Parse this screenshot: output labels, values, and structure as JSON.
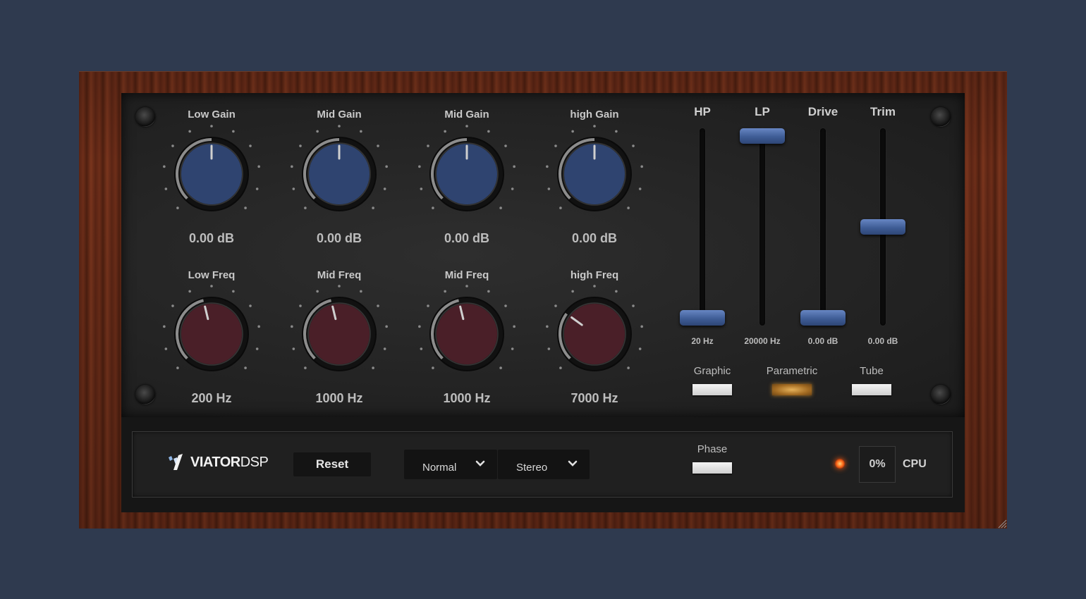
{
  "eq_gain": [
    {
      "label": "Low Gain",
      "value": "0.00 dB",
      "level": 0.5
    },
    {
      "label": "Mid Gain",
      "value": "0.00 dB",
      "level": 0.5
    },
    {
      "label": "Mid Gain",
      "value": "0.00 dB",
      "level": 0.5
    },
    {
      "label": "high Gain",
      "value": "0.00 dB",
      "level": 0.5
    }
  ],
  "eq_freq": [
    {
      "label": "Low Freq",
      "value": "200 Hz",
      "level": 0.45
    },
    {
      "label": "Mid Freq",
      "value": "1000 Hz",
      "level": 0.45
    },
    {
      "label": "Mid Freq",
      "value": "1000 Hz",
      "level": 0.45
    },
    {
      "label": "high Freq",
      "value": "7000 Hz",
      "level": 0.3
    }
  ],
  "sliders": [
    {
      "label": "HP",
      "value": "20 Hz",
      "level": 0.0
    },
    {
      "label": "LP",
      "value": "20000 Hz",
      "level": 1.0
    },
    {
      "label": "Drive",
      "value": "0.00 dB",
      "level": 0.0
    },
    {
      "label": "Trim",
      "value": "0.00 dB",
      "level": 0.5
    }
  ],
  "modes": [
    {
      "label": "Graphic",
      "active": false
    },
    {
      "label": "Parametric",
      "active": true
    },
    {
      "label": "Tube",
      "active": false
    }
  ],
  "footer": {
    "logo_brand": "VIATOR",
    "logo_suffix": "DSP",
    "reset_label": "Reset",
    "mode_select": "Normal",
    "channel_select": "Stereo",
    "phase_label": "Phase",
    "phase_active": false,
    "cpu_value": "0%",
    "cpu_label": "CPU"
  },
  "colors": {
    "gain_knob": "#2f4470",
    "freq_knob": "#4a1f28",
    "slider_thumb": "#4a68a6",
    "accent": "#ff6b1a"
  }
}
